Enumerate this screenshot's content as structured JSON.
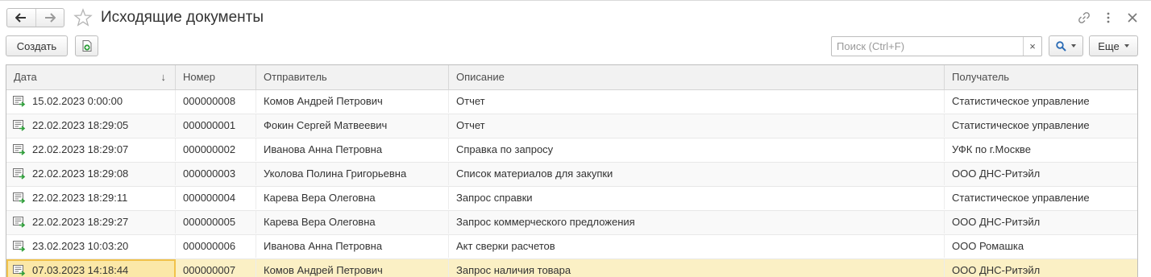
{
  "window": {
    "title": "Исходящие документы"
  },
  "toolbar": {
    "create_label": "Создать",
    "search_placeholder": "Поиск (Ctrl+F)",
    "search_clear": "×",
    "more_label": "Еще"
  },
  "table": {
    "columns": [
      "Дата",
      "Номер",
      "Отправитель",
      "Описание",
      "Получатель"
    ],
    "sort_column": "Дата",
    "rows": [
      {
        "date": "15.02.2023 0:00:00",
        "number": "000000008",
        "sender": "Комов Андрей Петрович",
        "description": "Отчет",
        "recipient": "Статистическое управление"
      },
      {
        "date": "22.02.2023 18:29:05",
        "number": "000000001",
        "sender": "Фокин Сергей Матвеевич",
        "description": "Отчет",
        "recipient": "Статистическое управление"
      },
      {
        "date": "22.02.2023 18:29:07",
        "number": "000000002",
        "sender": "Иванова Анна Петровна",
        "description": "Справка по запросу",
        "recipient": "УФК по г.Москве"
      },
      {
        "date": "22.02.2023 18:29:08",
        "number": "000000003",
        "sender": "Уколова Полина Григорьевна",
        "description": "Список материалов для закупки",
        "recipient": "ООО ДНС-Ритэйл"
      },
      {
        "date": "22.02.2023 18:29:11",
        "number": "000000004",
        "sender": "Карева Вера Олеговна",
        "description": "Запрос справки",
        "recipient": "Статистическое управление"
      },
      {
        "date": "22.02.2023 18:29:27",
        "number": "000000005",
        "sender": "Карева Вера Олеговна",
        "description": "Запрос коммерческого предложения",
        "recipient": "ООО ДНС-Ритэйл"
      },
      {
        "date": "23.02.2023 10:03:20",
        "number": "000000006",
        "sender": "Иванова Анна Петровна",
        "description": "Акт сверки расчетов",
        "recipient": "ООО Ромашка"
      },
      {
        "date": "07.03.2023 14:18:44",
        "number": "000000007",
        "sender": "Комов Андрей Петрович",
        "description": "Запрос наличия товара",
        "recipient": "ООО ДНС-Ритэйл",
        "selected": true
      }
    ]
  },
  "colors": {
    "selected_row": "#fbf0c5",
    "selected_cell_border": "#f1c24a",
    "header_bg": "#f2f2f2",
    "search_button_accent": "#2a6bb5"
  },
  "icons": {
    "back": "arrow-left-icon",
    "forward": "arrow-right-icon",
    "favorite": "star-icon",
    "link": "link-icon",
    "menu": "kebab-menu-icon",
    "close": "close-icon",
    "create_by_copy": "document-add-icon",
    "search": "search-icon",
    "row_document": "outgoing-document-icon"
  }
}
